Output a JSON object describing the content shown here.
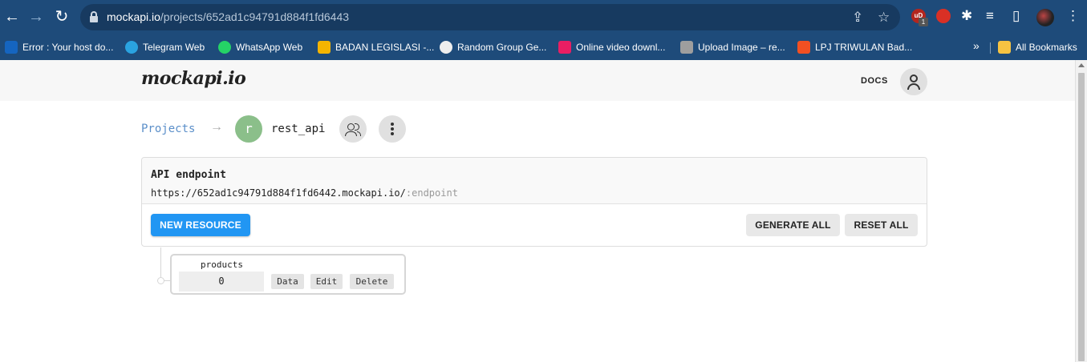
{
  "browser": {
    "url_host": "mockapi.io",
    "url_path": "/projects/652ad1c94791d884f1fd6443",
    "ext_badge": "1",
    "bookmarks": [
      {
        "label": "Error : Your host do...",
        "color": "#1565c0"
      },
      {
        "label": "Telegram Web",
        "color": "#2aa3e0"
      },
      {
        "label": "WhatsApp Web",
        "color": "#25d366"
      },
      {
        "label": "BADAN LEGISLASI -...",
        "color": "#f4b400"
      },
      {
        "label": "Random Group Ge...",
        "color": "#eeeeee"
      },
      {
        "label": "Online video downl...",
        "color": "#e91e63"
      },
      {
        "label": "Upload Image – re...",
        "color": "#9e9e9e"
      },
      {
        "label": "LPJ TRIWULAN Bad...",
        "color": "#f25022"
      }
    ],
    "all_bookmarks": "All Bookmarks"
  },
  "header": {
    "logo": "mockapi.io",
    "docs": "DOCS"
  },
  "breadcrumb": {
    "projects": "Projects",
    "arrow": "→",
    "project_initial": "r",
    "project_name": "rest_api"
  },
  "endpoint": {
    "title": "API endpoint",
    "url": "https://652ad1c94791d884f1fd6442.mockapi.io/",
    "placeholder": ":endpoint"
  },
  "actions": {
    "new_resource": "NEW RESOURCE",
    "generate_all": "GENERATE ALL",
    "reset_all": "RESET ALL"
  },
  "resources": [
    {
      "name": "products",
      "count": "0",
      "data_label": "Data",
      "edit_label": "Edit",
      "delete_label": "Delete"
    }
  ],
  "colors": {
    "chrome": "#1e4b7a",
    "primary": "#2196f3",
    "link": "#5b8fc9",
    "project_avatar": "#8bbf8a"
  }
}
